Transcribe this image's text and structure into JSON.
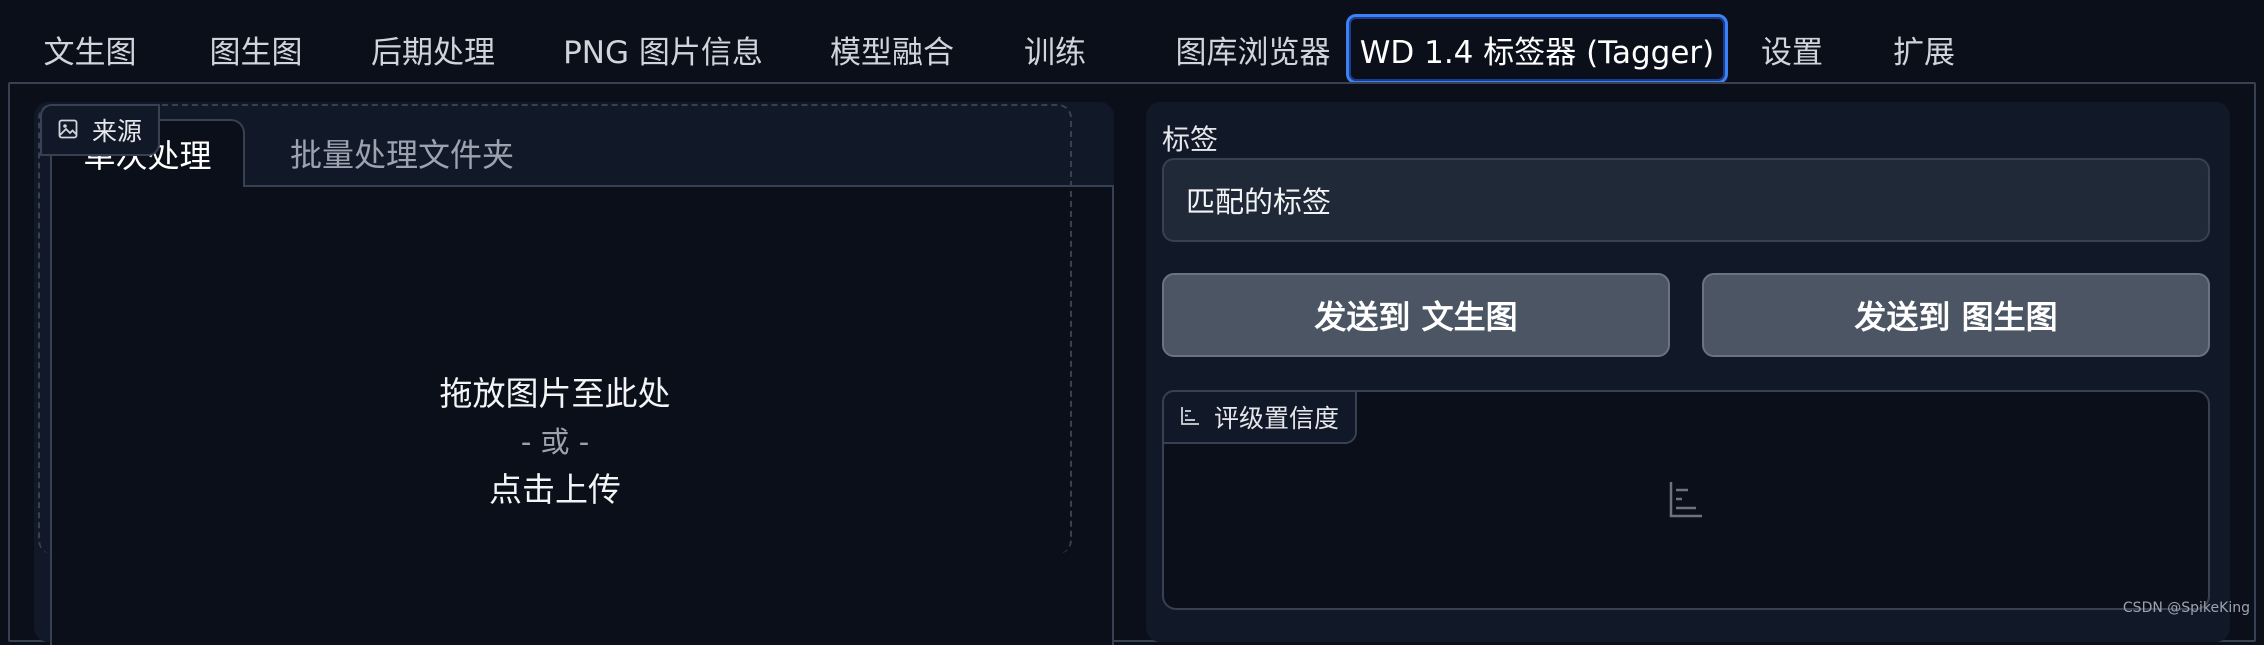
{
  "nav": {
    "tabs": [
      {
        "label": "文生图"
      },
      {
        "label": "图生图"
      },
      {
        "label": "后期处理"
      },
      {
        "label": "PNG 图片信息"
      },
      {
        "label": "模型融合"
      },
      {
        "label": "训练"
      },
      {
        "label": "图库浏览器"
      },
      {
        "label": "WD 1.4 标签器 (Tagger)",
        "active": true
      },
      {
        "label": "设置"
      },
      {
        "label": "扩展"
      }
    ]
  },
  "left": {
    "subtabs": [
      {
        "label": "单次处理",
        "active": true
      },
      {
        "label": "批量处理文件夹"
      }
    ],
    "source_label": "来源",
    "source_icon": "image-icon",
    "drop_line1": "拖放图片至此处",
    "drop_line2": "- 或 -",
    "drop_line3": "点击上传"
  },
  "right": {
    "tags_label": "标签",
    "tags_value": "匹配的标签",
    "send_txt2img": "发送到 文生图",
    "send_img2img": "发送到 图生图",
    "rating_label": "评级置信度",
    "rating_icon": "bar-chart-icon"
  },
  "watermark": "CSDN @SpikeKing",
  "colors": {
    "background": "#0b0f19",
    "panel": "#111827",
    "border": "#374151",
    "active_tab_border": "#3b82f6",
    "button": "#4b5563"
  }
}
